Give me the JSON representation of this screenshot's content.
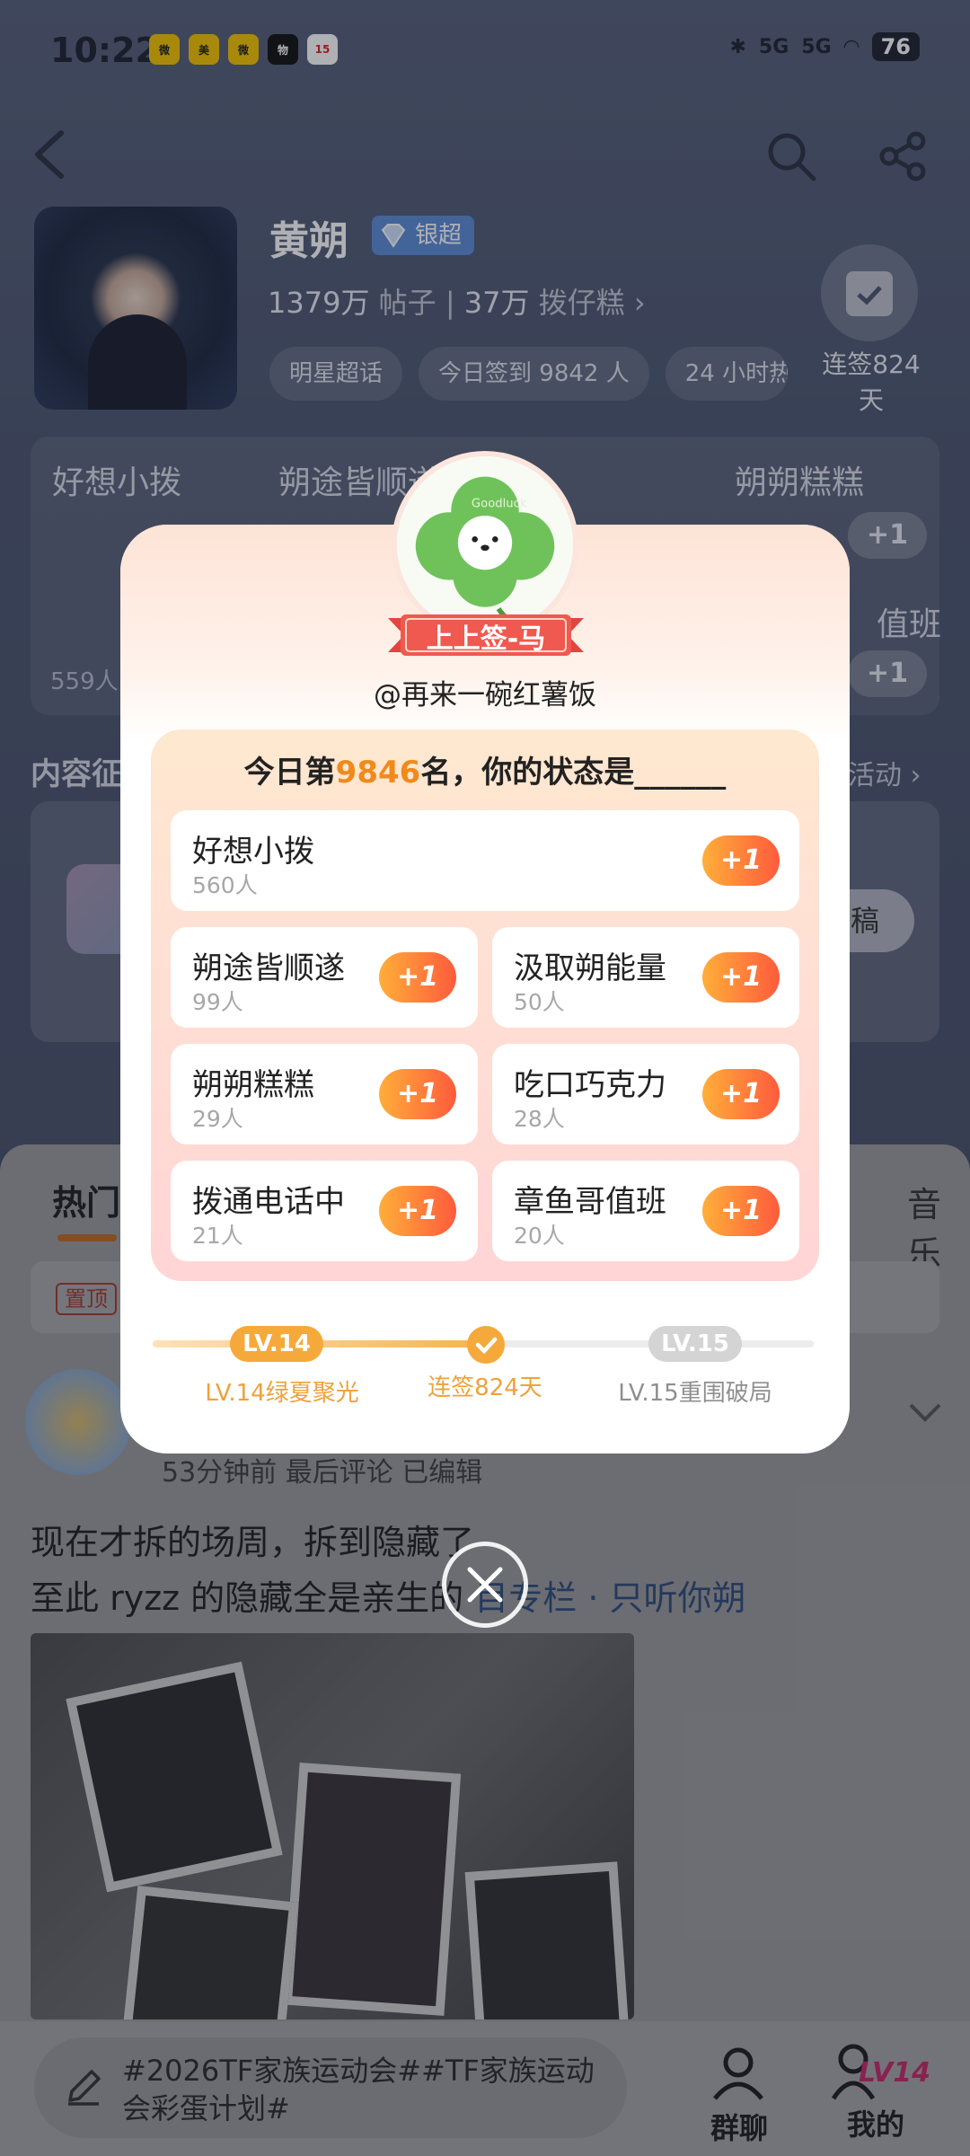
{
  "status_bar": {
    "time": "10:22",
    "network": "5G",
    "network2": "5G",
    "battery": "76"
  },
  "profile": {
    "name": "黄朔",
    "badge": "银超",
    "posts_count": "1379万",
    "posts_label": "帖子",
    "fans_count": "37万",
    "fans_label": "拨仔糕",
    "chips": [
      "明星超话",
      "今日签到 9842 人",
      "24 小时热"
    ],
    "checkin_label": "连签824天"
  },
  "bg_status_panel": {
    "items": [
      "好想小拨",
      "朔途皆顺遂",
      "汲取朔能量",
      "朔朔糕糕",
      "值班"
    ],
    "count": "559人",
    "plus": "+1"
  },
  "content_section": {
    "title": "内容征",
    "more": "活动",
    "button": "稿"
  },
  "feed": {
    "tab_hot": "热门",
    "tab_music": "音乐",
    "pin_tag": "置顶",
    "post_meta": "53分钟前 最后评论   已编辑",
    "post_line1": "现在才拆的场周，拆到隐藏了",
    "post_line2": "至此 ryzz 的隐藏全是亲生的",
    "post_link": "专栏 · 只听你朔"
  },
  "bottom_bar": {
    "compose_text": "#2026TF家族运动会##TF家族运动会彩蛋计划#",
    "tab_group": "群聊",
    "tab_mine": "我的",
    "mine_badge": "LV14"
  },
  "modal": {
    "sticker_text": "Goodluck",
    "ribbon": "上上签-马",
    "username": "@再来一碗红薯饭",
    "rank_prefix": "今日第",
    "rank_number": "9846",
    "rank_suffix": "名，你的状态是______",
    "options": [
      {
        "label": "好想小拨",
        "count": "560人",
        "plus": "+1"
      },
      {
        "label": "朔途皆顺遂",
        "count": "99人",
        "plus": "+1"
      },
      {
        "label": "汲取朔能量",
        "count": "50人",
        "plus": "+1"
      },
      {
        "label": "朔朔糕糕",
        "count": "29人",
        "plus": "+1"
      },
      {
        "label": "吃口巧克力",
        "count": "28人",
        "plus": "+1"
      },
      {
        "label": "拨通电话中",
        "count": "21人",
        "plus": "+1"
      },
      {
        "label": "章鱼哥值班",
        "count": "20人",
        "plus": "+1"
      }
    ],
    "level_current": "LV.14",
    "level_current_name": "LV.14绿夏聚光",
    "streak": "连签824天",
    "level_next": "LV.15",
    "level_next_name": "LV.15重围破局",
    "accent_color": "#f08a1c"
  }
}
